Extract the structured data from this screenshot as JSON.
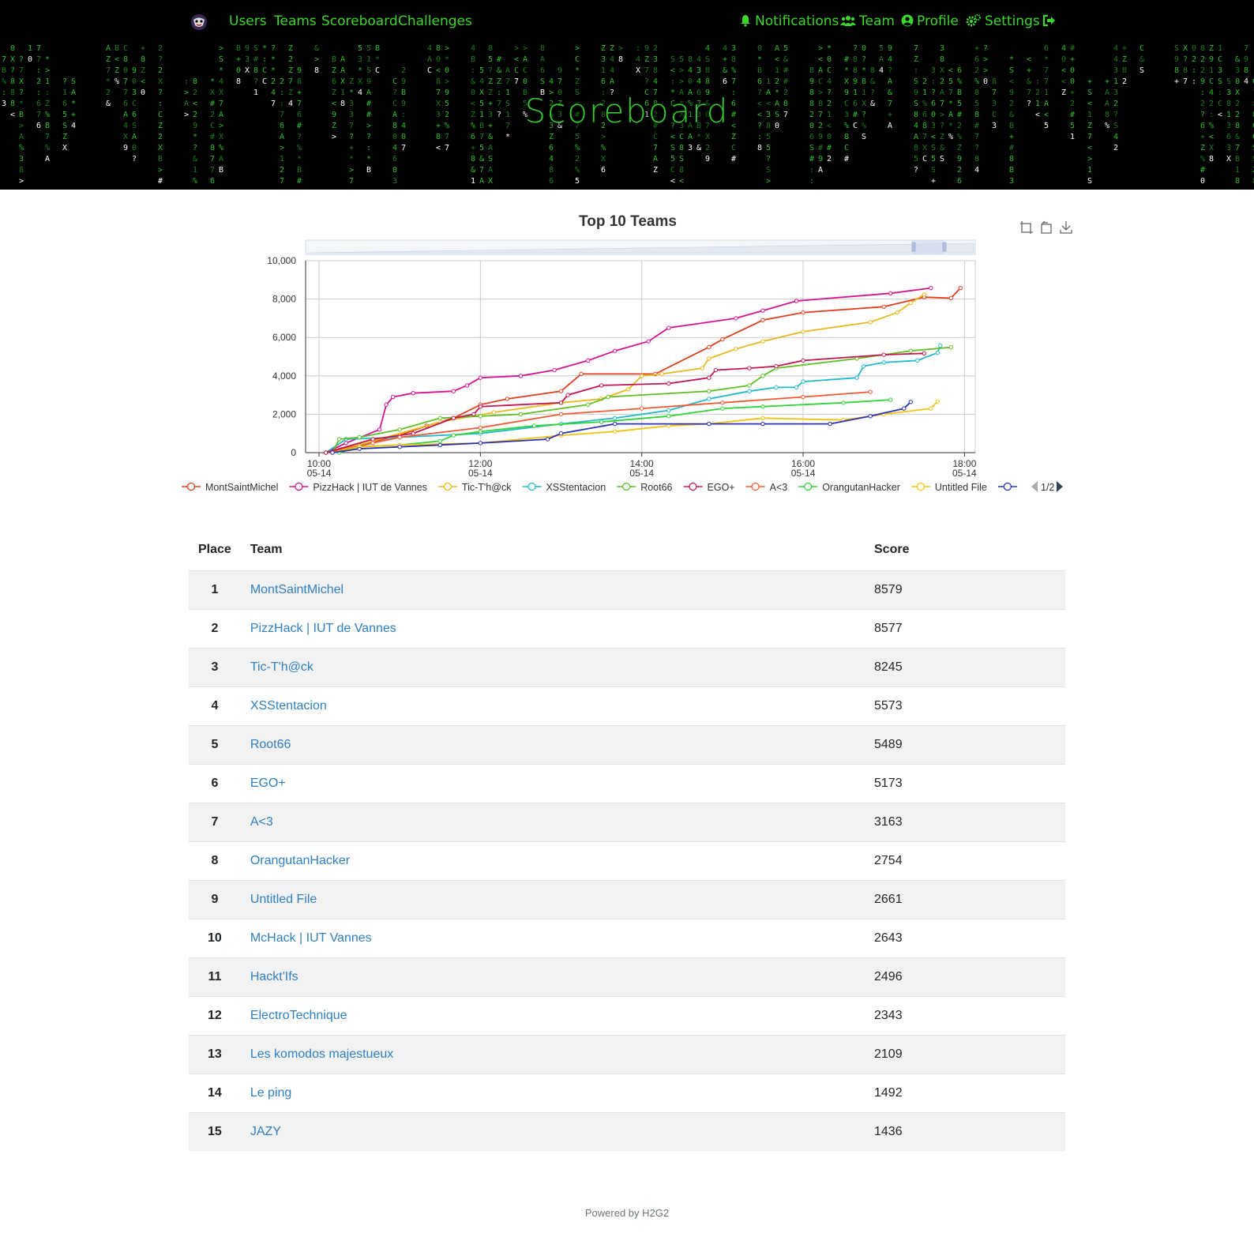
{
  "nav": {
    "logo_icon": "hacker-mask-icon",
    "left": [
      "Users",
      "Teams",
      "Scoreboard",
      "Challenges"
    ],
    "right": [
      {
        "label": "Notifications",
        "icon": "bell-icon"
      },
      {
        "label": "Team",
        "icon": "users-icon"
      },
      {
        "label": "Profile",
        "icon": "user-circle-icon"
      },
      {
        "label": "Settings",
        "icon": "gears-icon"
      }
    ],
    "logout_icon": "sign-out-icon",
    "accent": "#3cd62c"
  },
  "hero": {
    "title": "Scoreboard"
  },
  "chart_data": {
    "type": "line",
    "title": "Top 10 Teams",
    "x_axis": {
      "type": "time",
      "ticks": [
        [
          "10:00",
          "05-14"
        ],
        [
          "12:00",
          "05-14"
        ],
        [
          "14:00",
          "05-14"
        ],
        [
          "16:00",
          "05-14"
        ],
        [
          "18:00",
          "05-14"
        ]
      ]
    },
    "y_axis": {
      "ylim": [
        0,
        10000
      ],
      "ticks": [
        "0",
        "2,000",
        "4,000",
        "6,000",
        "8,000",
        "10,000"
      ]
    },
    "grid": true,
    "legend_position": "bottom",
    "legend_page": "1/2",
    "series": [
      {
        "name": "MontSaintMichel",
        "color": "#e03f1f",
        "points": [
          [
            "10:05",
            0
          ],
          [
            "10:30",
            400
          ],
          [
            "11:00",
            900
          ],
          [
            "11:20",
            1400
          ],
          [
            "11:40",
            1800
          ],
          [
            "12:00",
            2500
          ],
          [
            "12:20",
            2800
          ],
          [
            "13:00",
            3200
          ],
          [
            "13:15",
            4100
          ],
          [
            "14:10",
            4100
          ],
          [
            "14:50",
            5500
          ],
          [
            "15:00",
            5900
          ],
          [
            "15:30",
            6900
          ],
          [
            "16:00",
            7300
          ],
          [
            "17:00",
            7600
          ],
          [
            "17:30",
            8100
          ],
          [
            "17:50",
            8050
          ],
          [
            "17:57",
            8579
          ]
        ]
      },
      {
        "name": "PizzHack | IUT de Vannes",
        "color": "#d6138f",
        "points": [
          [
            "10:05",
            0
          ],
          [
            "10:20",
            500
          ],
          [
            "10:45",
            1200
          ],
          [
            "10:50",
            2500
          ],
          [
            "10:55",
            2900
          ],
          [
            "11:10",
            3100
          ],
          [
            "11:40",
            3200
          ],
          [
            "11:50",
            3500
          ],
          [
            "12:00",
            3900
          ],
          [
            "12:30",
            4000
          ],
          [
            "12:55",
            4300
          ],
          [
            "13:20",
            4800
          ],
          [
            "13:40",
            5300
          ],
          [
            "14:05",
            5800
          ],
          [
            "14:20",
            6500
          ],
          [
            "15:10",
            7000
          ],
          [
            "15:30",
            7400
          ],
          [
            "15:55",
            7900
          ],
          [
            "17:05",
            8300
          ],
          [
            "17:35",
            8577
          ]
        ]
      },
      {
        "name": "Tic-T'h@ck",
        "color": "#e8b81c",
        "points": [
          [
            "10:10",
            0
          ],
          [
            "10:40",
            600
          ],
          [
            "11:30",
            1600
          ],
          [
            "12:10",
            2100
          ],
          [
            "13:00",
            2600
          ],
          [
            "13:30",
            2800
          ],
          [
            "13:50",
            3300
          ],
          [
            "14:00",
            4000
          ],
          [
            "14:15",
            4100
          ],
          [
            "14:45",
            4400
          ],
          [
            "14:50",
            4900
          ],
          [
            "15:10",
            5400
          ],
          [
            "15:30",
            5800
          ],
          [
            "16:00",
            6300
          ],
          [
            "16:50",
            6800
          ],
          [
            "17:10",
            7300
          ],
          [
            "17:20",
            7800
          ],
          [
            "17:30",
            8245
          ]
        ]
      },
      {
        "name": "XSStentacion",
        "color": "#22b9c9",
        "points": [
          [
            "10:05",
            0
          ],
          [
            "10:20",
            700
          ],
          [
            "11:00",
            800
          ],
          [
            "12:00",
            1000
          ],
          [
            "13:00",
            1500
          ],
          [
            "13:40",
            1800
          ],
          [
            "14:20",
            2200
          ],
          [
            "14:50",
            2800
          ],
          [
            "15:20",
            3200
          ],
          [
            "15:40",
            3400
          ],
          [
            "15:55",
            3400
          ],
          [
            "16:00",
            3700
          ],
          [
            "16:40",
            3900
          ],
          [
            "16:45",
            4500
          ],
          [
            "17:00",
            4700
          ],
          [
            "17:25",
            4800
          ],
          [
            "17:40",
            5200
          ],
          [
            "17:42",
            5573
          ]
        ]
      },
      {
        "name": "Root66",
        "color": "#5fbf24",
        "points": [
          [
            "10:10",
            0
          ],
          [
            "10:15",
            700
          ],
          [
            "10:30",
            800
          ],
          [
            "11:00",
            1200
          ],
          [
            "11:30",
            1800
          ],
          [
            "12:00",
            1900
          ],
          [
            "12:30",
            2000
          ],
          [
            "13:20",
            2500
          ],
          [
            "13:35",
            2900
          ],
          [
            "14:50",
            3200
          ],
          [
            "15:20",
            3500
          ],
          [
            "15:30",
            4000
          ],
          [
            "15:40",
            4400
          ],
          [
            "16:40",
            4900
          ],
          [
            "17:20",
            5300
          ],
          [
            "17:50",
            5489
          ]
        ]
      },
      {
        "name": "EGO+",
        "color": "#c4164d",
        "points": [
          [
            "10:05",
            0
          ],
          [
            "10:40",
            700
          ],
          [
            "11:10",
            1000
          ],
          [
            "11:40",
            1800
          ],
          [
            "11:55",
            2000
          ],
          [
            "12:00",
            2400
          ],
          [
            "13:00",
            2600
          ],
          [
            "13:05",
            3000
          ],
          [
            "13:30",
            3500
          ],
          [
            "14:20",
            3600
          ],
          [
            "14:50",
            3900
          ],
          [
            "14:55",
            4300
          ],
          [
            "15:20",
            4400
          ],
          [
            "15:40",
            4500
          ],
          [
            "16:00",
            4800
          ],
          [
            "17:00",
            5100
          ],
          [
            "17:30",
            5173
          ]
        ]
      },
      {
        "name": "A<3",
        "color": "#ef5a32",
        "points": [
          [
            "10:10",
            0
          ],
          [
            "10:40",
            500
          ],
          [
            "11:00",
            800
          ],
          [
            "12:00",
            1300
          ],
          [
            "13:00",
            2000
          ],
          [
            "14:00",
            2300
          ],
          [
            "15:00",
            2600
          ],
          [
            "16:00",
            2900
          ],
          [
            "16:50",
            3163
          ]
        ]
      },
      {
        "name": "OrangutanHacker",
        "color": "#2fd435",
        "points": [
          [
            "10:15",
            0
          ],
          [
            "10:30",
            300
          ],
          [
            "11:00",
            400
          ],
          [
            "11:30",
            600
          ],
          [
            "11:40",
            900
          ],
          [
            "12:00",
            1100
          ],
          [
            "12:40",
            1400
          ],
          [
            "13:30",
            1600
          ],
          [
            "14:20",
            1900
          ],
          [
            "15:00",
            2300
          ],
          [
            "15:30",
            2400
          ],
          [
            "16:30",
            2600
          ],
          [
            "17:05",
            2754
          ]
        ]
      },
      {
        "name": "Untitled File",
        "color": "#f1c20d",
        "points": [
          [
            "10:10",
            0
          ],
          [
            "10:30",
            300
          ],
          [
            "11:00",
            400
          ],
          [
            "12:00",
            500
          ],
          [
            "13:00",
            900
          ],
          [
            "13:40",
            1100
          ],
          [
            "14:20",
            1400
          ],
          [
            "14:50",
            1500
          ],
          [
            "15:30",
            1800
          ],
          [
            "16:30",
            1700
          ],
          [
            "17:00",
            2000
          ],
          [
            "17:35",
            2300
          ],
          [
            "17:40",
            2661
          ]
        ]
      },
      {
        "name": "",
        "color": "#2a2fb5",
        "points": [
          [
            "10:10",
            0
          ],
          [
            "10:30",
            200
          ],
          [
            "11:00",
            300
          ],
          [
            "11:30",
            400
          ],
          [
            "12:00",
            500
          ],
          [
            "12:50",
            700
          ],
          [
            "13:00",
            1000
          ],
          [
            "13:40",
            1500
          ],
          [
            "14:50",
            1500
          ],
          [
            "15:30",
            1500
          ],
          [
            "16:20",
            1500
          ],
          [
            "16:50",
            1900
          ],
          [
            "17:15",
            2300
          ],
          [
            "17:20",
            2643
          ]
        ]
      }
    ]
  },
  "chart_tools": [
    "zoom-select-icon",
    "zoom-reset-icon",
    "download-icon"
  ],
  "table": {
    "headers": {
      "place": "Place",
      "team": "Team",
      "score": "Score"
    },
    "rows": [
      {
        "place": "1",
        "team": "MontSaintMichel",
        "score": "8579"
      },
      {
        "place": "2",
        "team": "PizzHack | IUT de Vannes",
        "score": "8577"
      },
      {
        "place": "3",
        "team": "Tic-T'h@ck",
        "score": "8245"
      },
      {
        "place": "4",
        "team": "XSStentacion",
        "score": "5573"
      },
      {
        "place": "5",
        "team": "Root66",
        "score": "5489"
      },
      {
        "place": "6",
        "team": "EGO+",
        "score": "5173"
      },
      {
        "place": "7",
        "team": "A<3",
        "score": "3163"
      },
      {
        "place": "8",
        "team": "OrangutanHacker",
        "score": "2754"
      },
      {
        "place": "9",
        "team": "Untitled File",
        "score": "2661"
      },
      {
        "place": "10",
        "team": "McHack | IUT Vannes",
        "score": "2643"
      },
      {
        "place": "11",
        "team": "Hackt'Ifs",
        "score": "2496"
      },
      {
        "place": "12",
        "team": "ElectroTechnique",
        "score": "2343"
      },
      {
        "place": "13",
        "team": "Les komodos majestueux",
        "score": "2109"
      },
      {
        "place": "14",
        "team": "Le ping",
        "score": "1492"
      },
      {
        "place": "15",
        "team": "JAZY",
        "score": "1436"
      }
    ]
  },
  "footer": {
    "text": "Powered by H2G2"
  }
}
